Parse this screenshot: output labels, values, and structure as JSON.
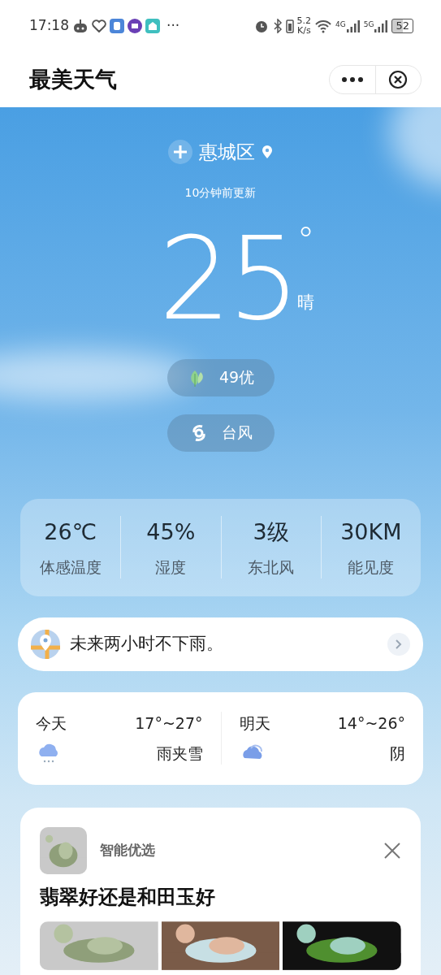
{
  "status_bar": {
    "time": "17:18",
    "more": "···",
    "speed": "5.2",
    "speed_unit": "K/s",
    "net1": "4G",
    "net2": "5G",
    "battery": "52"
  },
  "header": {
    "title": "最美天气"
  },
  "location": {
    "name": "惠城区",
    "updated": "10分钟前更新"
  },
  "current": {
    "temperature": "25",
    "degree": "°",
    "condition": "晴"
  },
  "badges": [
    {
      "kind": "aqi",
      "label": "49优"
    },
    {
      "kind": "typhoon",
      "label": "台风"
    }
  ],
  "stats": [
    {
      "value": "26℃",
      "label": "体感温度"
    },
    {
      "value": "45%",
      "label": "湿度"
    },
    {
      "value": "3级",
      "label": "东北风"
    },
    {
      "value": "30KM",
      "label": "能见度"
    }
  ],
  "rain_notice": "未来两小时不下雨。",
  "forecast": [
    {
      "day": "今天",
      "range": "17°~27°",
      "condition": "雨夹雪",
      "kind": "sleet"
    },
    {
      "day": "明天",
      "range": "14°~26°",
      "condition": "阴",
      "kind": "cloudy"
    }
  ],
  "ad": {
    "source": "智能优选",
    "title": "翡翠好还是和田玉好"
  }
}
